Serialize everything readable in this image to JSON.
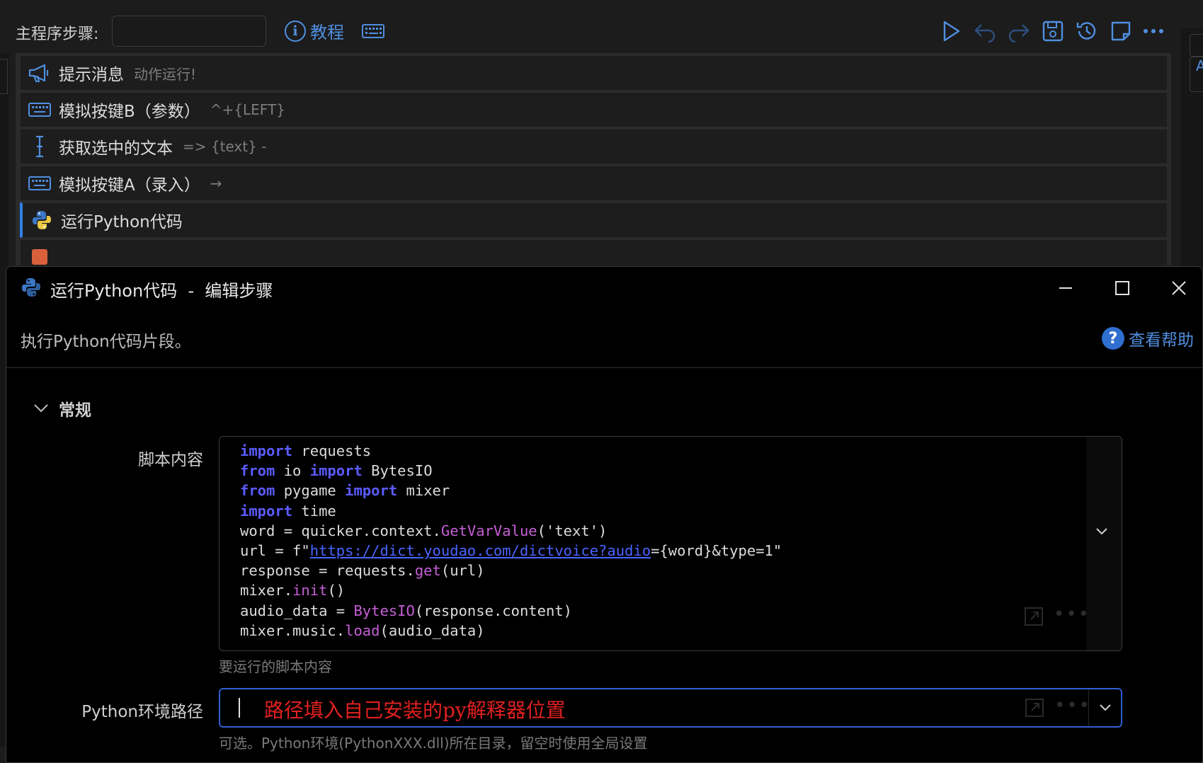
{
  "toolbar": {
    "main_steps_label": "主程序步骤:",
    "filter_value": "",
    "tutorial_label": "教程"
  },
  "steps": [
    {
      "title": "提示消息",
      "desc": "动作运行!",
      "icon": "megaphone-icon"
    },
    {
      "title": "模拟按键B（参数）",
      "desc": "^+{LEFT}",
      "icon": "keyboard-icon"
    },
    {
      "title": "获取选中的文本",
      "desc": "=> {text} -",
      "icon": "text-cursor-icon"
    },
    {
      "title": "模拟按键A（录入）",
      "desc": "→",
      "icon": "keyboard-icon"
    },
    {
      "title": "运行Python代码",
      "desc": "",
      "icon": "python-icon",
      "selected": true
    }
  ],
  "dialog": {
    "title": "运行Python代码  -  编辑步骤",
    "description": "执行Python代码片段。",
    "help_label": "查看帮助",
    "section_title": "常规",
    "script_label": "脚本内容",
    "script_hint": "要运行的脚本内容",
    "code_lines": [
      "import requests",
      "from io import BytesIO",
      "from pygame import mixer",
      "import time",
      "word = quicker.context.GetVarValue('text')",
      "url = f\"https://dict.youdao.com/dictvoice?audio={word}&type=1\"",
      "response = requests.get(url)",
      "mixer.init()",
      "audio_data = BytesIO(response.content)",
      "mixer.music.load(audio_data)"
    ],
    "python_path_label": "Python环境路径",
    "python_path_value": "路径填入自己安装的py解释器位置",
    "python_path_hint": "可选。Python环境(PythonXXX.dll)所在目录，留空时使用全局设置"
  },
  "colors": {
    "accent": "#4f8fe0",
    "keyword": "#5b5bff",
    "function": "#c55fd6",
    "annotation_red": "#e02020"
  }
}
